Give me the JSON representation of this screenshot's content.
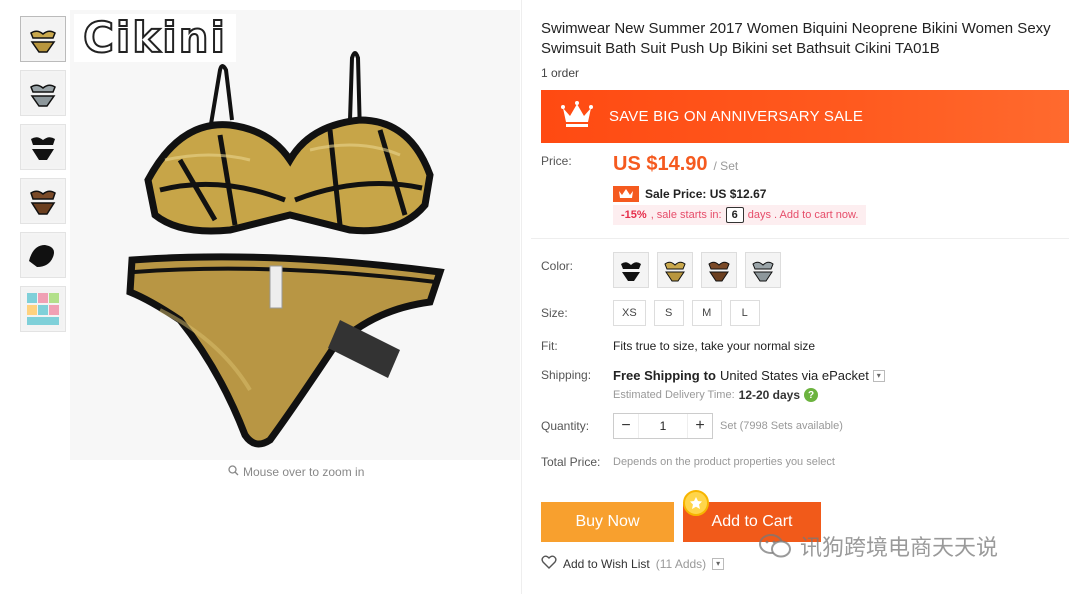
{
  "gallery": {
    "thumbnails": [
      "gold-bikini",
      "grey-bikini",
      "black-bikini",
      "bronze-bikini",
      "black-bikini-alt",
      "size-chart"
    ],
    "logo_text": "Cikini",
    "zoom_hint": "Mouse over to zoom in"
  },
  "product": {
    "title": "Swimwear New Summer 2017 Women Biquini Neoprene Bikini Women Sexy Swimsuit Bath Suit Push Up Bikini set Bathsuit Cikini TA01B",
    "orders": "1 order"
  },
  "banner": {
    "text": "SAVE BIG ON ANNIVERSARY SALE",
    "color": "#ff4a12"
  },
  "price": {
    "label": "Price:",
    "amount": "US $14.90",
    "unit": "/ Set",
    "sale_label": "Sale Price: US $12.67",
    "discount": "-15%",
    "notice_pre": ", sale starts in:",
    "days": "6",
    "notice_post": "days . Add to cart now."
  },
  "color": {
    "label": "Color:",
    "options": [
      "black",
      "gold",
      "bronze",
      "grey"
    ]
  },
  "size": {
    "label": "Size:",
    "options": [
      "XS",
      "S",
      "M",
      "L"
    ]
  },
  "fit": {
    "label": "Fit:",
    "text": "Fits true to size, take your normal size"
  },
  "shipping": {
    "label": "Shipping:",
    "free": "Free Shipping",
    "to": "to",
    "destination": "United States via ePacket",
    "est_label": "Estimated Delivery Time:",
    "est_days": "12-20 days"
  },
  "quantity": {
    "label": "Quantity:",
    "value": "1",
    "available": "Set (7998 Sets available)"
  },
  "total": {
    "label": "Total Price:",
    "text": "Depends on the product properties you select"
  },
  "actions": {
    "buy_now": "Buy Now",
    "add_to_cart": "Add to Cart",
    "wish_label": "Add to Wish List",
    "wish_count": "(11 Adds)"
  },
  "watermark": {
    "text": "讯狗跨境电商天天说"
  },
  "colors": {
    "accent": "#f55a1f",
    "buy": "#f8a02e",
    "cart": "#f15a1a"
  }
}
